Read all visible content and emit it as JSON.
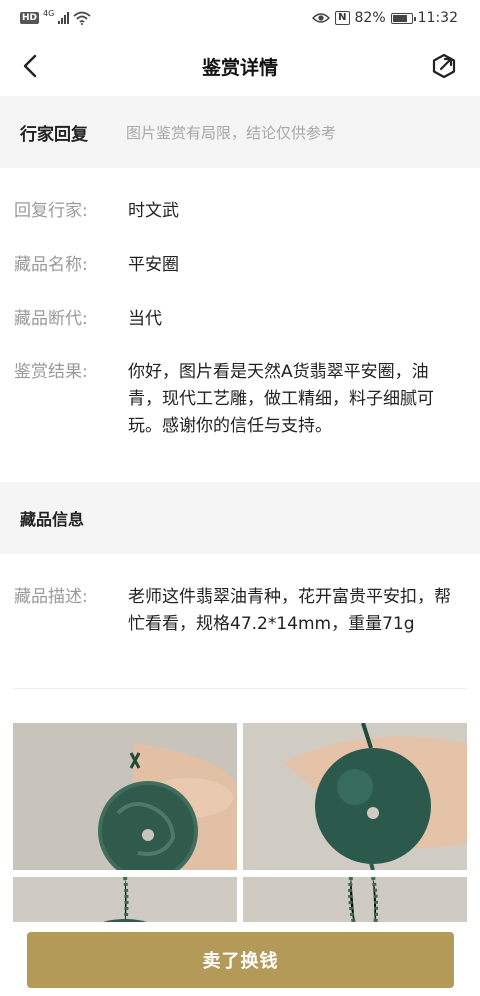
{
  "status_bar": {
    "hd": "HD",
    "network": "4G",
    "battery_percent": "82%",
    "time": "11:32",
    "battery_level": 0.82,
    "icons": [
      "signal-icon",
      "wifi-icon",
      "eye-icon",
      "nfc-icon",
      "battery-icon"
    ]
  },
  "header": {
    "title": "鉴赏详情",
    "back_icon": "chevron-left-icon",
    "share_icon": "share-icon"
  },
  "expert_reply": {
    "section_title": "行家回复",
    "note": "图片鉴赏有局限，结论仅供参考",
    "rows": [
      {
        "label": "回复行家:",
        "value": "时文武"
      },
      {
        "label": "藏品名称:",
        "value": "平安圈"
      },
      {
        "label": "藏品断代:",
        "value": "当代"
      },
      {
        "label": "鉴赏结果:",
        "value": "你好，图片看是天然A货翡翠平安圈，油青，现代工艺雕，做工精细，料子细腻可玩。感谢你的信任与支持。"
      }
    ]
  },
  "item_info": {
    "section_title": "藏品信息",
    "description_label": "藏品描述:",
    "description_value": "老师这件翡翠油青种，花开富贵平安扣，帮忙看看，规格47.2*14mm，重量71g"
  },
  "photos": {
    "count_visible": 4,
    "subject": "jade-pendant-photo"
  },
  "actions": {
    "sell_label": "卖了换钱",
    "accent_color": "#b39a58"
  }
}
